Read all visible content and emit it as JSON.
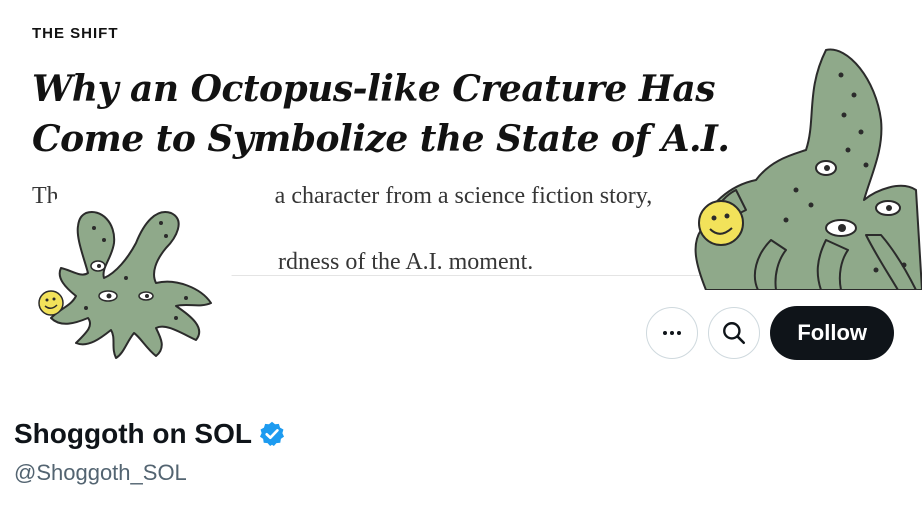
{
  "banner": {
    "kicker": "THE SHIFT",
    "headline_line1": "Why an Octopus-like Creature Has",
    "headline_line2": "Come to Symbolize the State of A.I.",
    "summary_line1": "Th                                    a character from a science fiction story, capture",
    "summary_line2": "                                         rdness of the A.I. moment."
  },
  "profile": {
    "display_name": "Shoggoth on SOL",
    "handle": "@Shoggoth_SOL",
    "verified": true
  },
  "actions": {
    "more_icon": "more-icon",
    "search_icon": "search-icon",
    "follow_label": "Follow"
  },
  "colors": {
    "creature": "#8fa98a",
    "creature_outline": "#2b2b2b",
    "smiley": "#f2e25a",
    "verified": "#1d9bf0",
    "follow_bg": "#0f1419"
  }
}
